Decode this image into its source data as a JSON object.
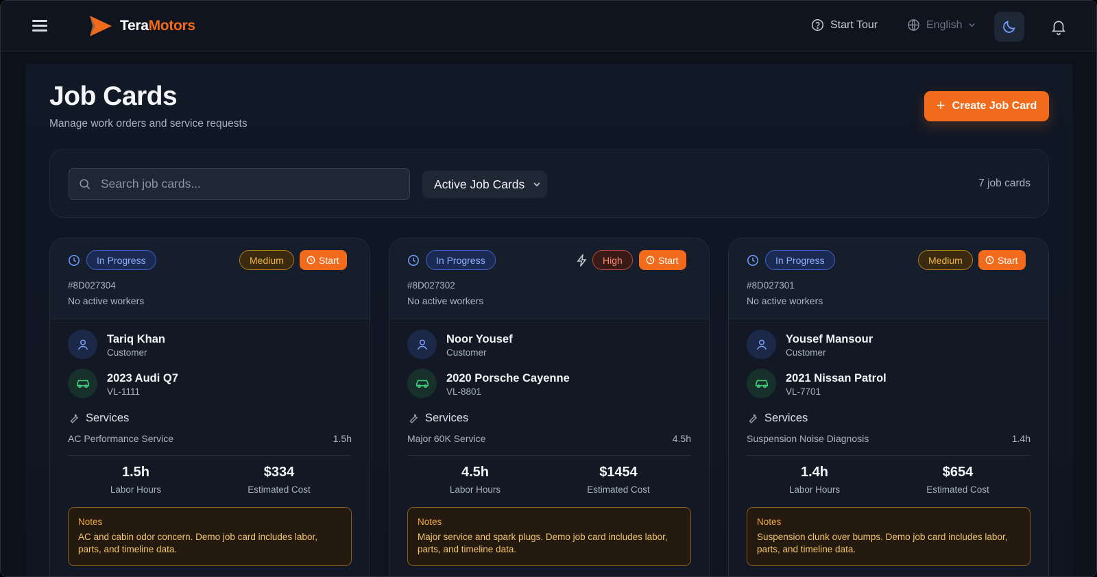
{
  "app": {
    "brand_part1": "Tera",
    "brand_part2": "Motors",
    "start_tour": "Start Tour",
    "language": "English"
  },
  "colors": {
    "accent": "#f26a1b",
    "status_blue": "#8fb0ff",
    "medium": "#f1b63a",
    "high": "#ff8a74"
  },
  "page": {
    "title": "Job Cards",
    "subtitle": "Manage work orders and service requests",
    "create_label": "Create Job Card"
  },
  "filters": {
    "search_placeholder": "Search job cards...",
    "status_filter": "Active Job Cards",
    "count_text": "7 job cards"
  },
  "cards": [
    {
      "status": "In Progress",
      "priority": "Medium",
      "start_label": "Start",
      "id": "#8D027304",
      "workers": "No active workers",
      "customer_name": "Tariq Khan",
      "customer_role": "Customer",
      "vehicle": "2023 Audi Q7",
      "plate": "VL-1111",
      "services_label": "Services",
      "service_name": "AC Performance Service",
      "service_hours": "1.5h",
      "labor_hours": "1.5h",
      "labor_label": "Labor Hours",
      "cost": "$334",
      "cost_label": "Estimated Cost",
      "notes_title": "Notes",
      "notes": "AC and cabin odor concern. Demo job card includes labor, parts, and timeline data."
    },
    {
      "status": "In Progress",
      "priority": "High",
      "start_label": "Start",
      "id": "#8D027302",
      "workers": "No active workers",
      "customer_name": "Noor Yousef",
      "customer_role": "Customer",
      "vehicle": "2020 Porsche Cayenne",
      "plate": "VL-8801",
      "services_label": "Services",
      "service_name": "Major 60K Service",
      "service_hours": "4.5h",
      "labor_hours": "4.5h",
      "labor_label": "Labor Hours",
      "cost": "$1454",
      "cost_label": "Estimated Cost",
      "notes_title": "Notes",
      "notes": "Major service and spark plugs. Demo job card includes labor, parts, and timeline data."
    },
    {
      "status": "In Progress",
      "priority": "Medium",
      "start_label": "Start",
      "id": "#8D027301",
      "workers": "No active workers",
      "customer_name": "Yousef Mansour",
      "customer_role": "Customer",
      "vehicle": "2021 Nissan Patrol",
      "plate": "VL-7701",
      "services_label": "Services",
      "service_name": "Suspension Noise Diagnosis",
      "service_hours": "1.4h",
      "labor_hours": "1.4h",
      "labor_label": "Labor Hours",
      "cost": "$654",
      "cost_label": "Estimated Cost",
      "notes_title": "Notes",
      "notes": "Suspension clunk over bumps. Demo job card includes labor, parts, and timeline data."
    }
  ]
}
